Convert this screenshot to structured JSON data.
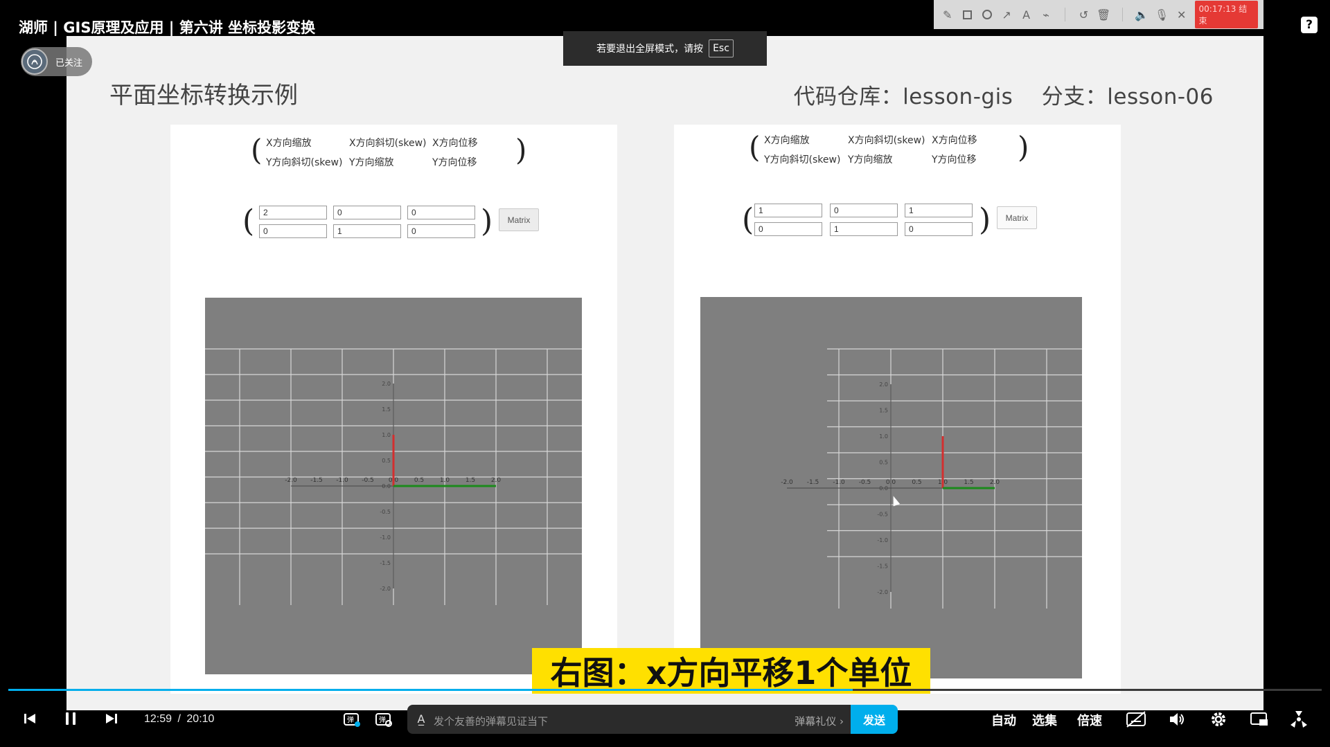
{
  "video": {
    "title": "湖师 | GIS原理及应用 | 第六讲 坐标投影变换",
    "follow_status": "已关注"
  },
  "fullscreen_tip": {
    "text": "若要退出全屏模式，请按",
    "key": "Esc"
  },
  "annotation_toolbar": {
    "tools": [
      "pencil-icon",
      "rectangle-icon",
      "circle-icon",
      "arrow-icon",
      "text-icon",
      "highlighter-icon",
      "undo-icon",
      "trash-icon",
      "speaker-icon",
      "microphone-icon",
      "close-icon"
    ],
    "recording_label": "00:17:13 结束"
  },
  "help": {
    "label": "?"
  },
  "slide": {
    "title": "平面坐标转换示例",
    "repo": "代码仓库：lesson-gis    分支：lesson-06",
    "subtitle": "右图：x方向平移1个单位",
    "legend": {
      "row1": [
        "X方向缩放",
        "X方向斜切(skew)",
        "X方向位移"
      ],
      "row2": [
        "Y方向斜切(skew)",
        "Y方向缩放",
        "Y方向位移"
      ]
    },
    "left_panel": {
      "matrix_row1": [
        "2",
        "0",
        "0"
      ],
      "matrix_row2": [
        "0",
        "1",
        "0"
      ],
      "button": "Matrix"
    },
    "right_panel": {
      "matrix_row1": [
        "1",
        "0",
        "1"
      ],
      "matrix_row2": [
        "0",
        "1",
        "0"
      ],
      "button": "Matrix"
    }
  },
  "chart_data": [
    {
      "type": "line",
      "x_ticks": [
        "-2.0",
        "-1.5",
        "-1.0",
        "-0.5",
        "0.0",
        "0.5",
        "1.0",
        "1.5",
        "2.0"
      ],
      "y_ticks": [
        "2.0",
        "1.5",
        "1.0",
        "0.5",
        "0.0",
        "-0.5",
        "-1.0",
        "-1.5",
        "-2.0"
      ],
      "xlim": [
        -2,
        2
      ],
      "ylim": [
        -2,
        2
      ],
      "grid": true,
      "series": [
        {
          "color": "#d32f2f",
          "x": [
            0,
            0
          ],
          "y": [
            0,
            1
          ]
        },
        {
          "color": "#1b8a1b",
          "x": [
            0,
            2
          ],
          "y": [
            0,
            0
          ]
        }
      ]
    },
    {
      "type": "line",
      "x_ticks": [
        "-2.0",
        "-1.5",
        "-1.0",
        "-0.5",
        "0.0",
        "0.5",
        "1.0",
        "1.5",
        "2.0"
      ],
      "y_ticks": [
        "2.0",
        "1.5",
        "1.0",
        "0.5",
        "0.0",
        "-0.5",
        "-1.0",
        "-1.5",
        "-2.0"
      ],
      "xlim": [
        -2,
        2
      ],
      "ylim": [
        -2,
        2
      ],
      "grid": true,
      "series": [
        {
          "color": "#d32f2f",
          "x": [
            1,
            1
          ],
          "y": [
            0,
            1
          ]
        },
        {
          "color": "#1b8a1b",
          "x": [
            1,
            2
          ],
          "y": [
            0,
            0
          ]
        }
      ]
    }
  ],
  "player": {
    "current_time": "12:59",
    "separator": "/",
    "duration": "20:10",
    "progress": 0.643,
    "danmaku_placeholder": "发个友善的弹幕见证当下",
    "danmaku_etiquette": "弹幕礼仪 ›",
    "send": "发送",
    "auto": "自动",
    "episodes": "选集",
    "speed": "倍速"
  }
}
